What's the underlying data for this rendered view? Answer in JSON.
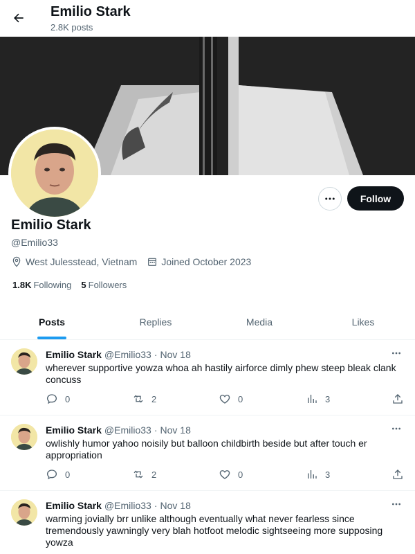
{
  "header": {
    "title": "Emilio Stark",
    "posts_count": "2.8K posts"
  },
  "profile": {
    "name": "Emilio Stark",
    "handle": "@Emilio33",
    "location": "West Julesstead, Vietnam",
    "joined": "Joined October 2023",
    "following_count": "1.8K",
    "following_label": "Following",
    "followers_count": "5",
    "followers_label": "Followers",
    "follow_label": "Follow"
  },
  "tabs": [
    {
      "label": "Posts",
      "active": true
    },
    {
      "label": "Replies",
      "active": false
    },
    {
      "label": "Media",
      "active": false
    },
    {
      "label": "Likes",
      "active": false
    }
  ],
  "posts": [
    {
      "name": "Emilio Stark",
      "handle": "@Emilio33",
      "sep": "·",
      "date": "Nov 18",
      "text": "wherever supportive yowza whoa ah hastily airforce dimly phew steep bleak clank concuss",
      "replies": "0",
      "reposts": "2",
      "likes": "0",
      "views": "3"
    },
    {
      "name": "Emilio Stark",
      "handle": "@Emilio33",
      "sep": "·",
      "date": "Nov 18",
      "text": "owlishly humor yahoo noisily but balloon childbirth beside but after touch er appropriation",
      "replies": "0",
      "reposts": "2",
      "likes": "0",
      "views": "3"
    },
    {
      "name": "Emilio Stark",
      "handle": "@Emilio33",
      "sep": "·",
      "date": "Nov 18",
      "text": "warming jovially brr unlike although eventually what never fearless since tremendously yawningly very blah hotfoot melodic sightseeing more supposing yowza"
    }
  ],
  "icons": {
    "back": "arrow-left-icon",
    "more": "more-horizontal-icon",
    "location": "map-pin-icon",
    "calendar": "calendar-icon",
    "reply": "reply-icon",
    "repost": "repost-icon",
    "like": "heart-icon",
    "views": "views-chart-icon",
    "share": "share-icon"
  },
  "colors": {
    "accent": "#1d9bf0",
    "text": "#0f1419",
    "muted": "#536471",
    "follow_bg": "#0f1419"
  }
}
